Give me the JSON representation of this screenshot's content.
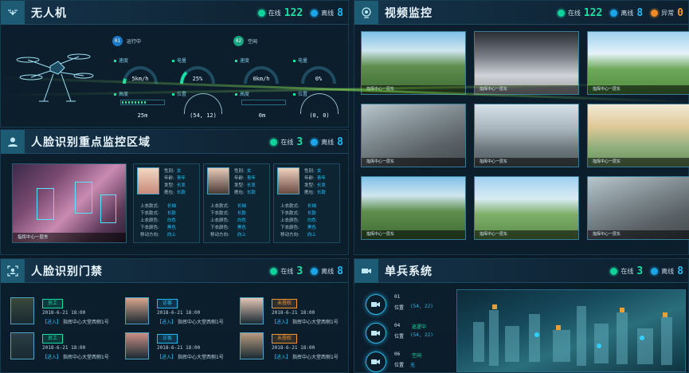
{
  "drone": {
    "title": "无人机",
    "online_label": "在线",
    "online": "122",
    "offline_label": "离线",
    "offline": "8",
    "units": [
      {
        "id": "01",
        "status": "运行中"
      },
      {
        "id": "02",
        "status": "空闲"
      }
    ],
    "labels": {
      "speed": "速度",
      "battery": "电量",
      "height": "高度",
      "position": "位置"
    },
    "readings": [
      {
        "speed": "5km/h",
        "battery": "25%",
        "height": "25m",
        "position": "(54, 12)",
        "speed_level": 0.1,
        "battery_level": 0.25
      },
      {
        "speed": "0km/h",
        "battery": "0%",
        "height": "0m",
        "position": "(0, 0)",
        "speed_level": 0,
        "battery_level": 0
      }
    ]
  },
  "face_zone": {
    "title": "人脸识别重点监控区域",
    "online_label": "在线",
    "online": "3",
    "offline_label": "离线",
    "offline": "8",
    "scene_caption": "指挥中心一层东",
    "field_labels": [
      "性别:",
      "年龄:",
      "发型:",
      "携包:"
    ],
    "cloth_labels": [
      "上衣款式:",
      "下衣款式:",
      "上衣颜色:",
      "下衣颜色:",
      "移动方向:"
    ],
    "persons": [
      {
        "gender": "女",
        "age": "青年",
        "hair": "长发",
        "bag": "长款",
        "top": "长袖",
        "bottom": "长款",
        "top_color": "白色",
        "bottom_color": "黑色",
        "dir": "向上"
      },
      {
        "gender": "女",
        "age": "青年",
        "hair": "长发",
        "bag": "长款",
        "top": "长袖",
        "bottom": "长款",
        "top_color": "白色",
        "bottom_color": "黑色",
        "dir": "向上"
      },
      {
        "gender": "女",
        "age": "青年",
        "hair": "长发",
        "bag": "长款",
        "top": "长袖",
        "bottom": "长款",
        "top_color": "白色",
        "bottom_color": "黑色",
        "dir": "向上"
      }
    ]
  },
  "video": {
    "title": "视频监控",
    "online_label": "在线",
    "online": "122",
    "offline_label": "离线",
    "offline": "8",
    "abnormal_label": "异常",
    "abnormal": "0",
    "caption": "指挥中心一层东"
  },
  "access": {
    "title": "人脸识别门禁",
    "online_label": "在线",
    "online": "3",
    "offline_label": "离线",
    "offline": "8",
    "entries": [
      {
        "tag": "员工",
        "type": "emp",
        "time": "2018-6-21  18:00",
        "action": "【进入】",
        "place": "指挥中心大堂西侧1号"
      },
      {
        "tag": "访客",
        "type": "vis",
        "time": "2018-6-21  18:00",
        "action": "【进入】",
        "place": "指挥中心大堂西侧1号"
      },
      {
        "tag": "未授权",
        "type": "una",
        "time": "2018-6-21  18:00",
        "action": "【进入】",
        "place": "指挥中心大堂西侧1号"
      },
      {
        "tag": "员工",
        "type": "emp",
        "time": "2018-6-21  18:00",
        "action": "【进入】",
        "place": "指挥中心大堂西侧1号"
      },
      {
        "tag": "访客",
        "type": "vis",
        "time": "2018-6-21  18:00",
        "action": "【进入】",
        "place": "指挥中心大堂西侧1号"
      },
      {
        "tag": "未授权",
        "type": "una",
        "time": "2018-6-21  18:00",
        "action": "【进入】",
        "place": "指挥中心大堂西侧1号"
      }
    ]
  },
  "soldier": {
    "title": "单兵系统",
    "online_label": "在线",
    "online": "3",
    "offline_label": "离线",
    "offline": "8",
    "position_label": "位置",
    "units": [
      {
        "id": "01",
        "status": "",
        "position": "(54, 22)"
      },
      {
        "id": "04",
        "status": "巡逻中",
        "position": "(54, 22)"
      },
      {
        "id": "06",
        "status": "空闲",
        "position": "无"
      }
    ]
  }
}
